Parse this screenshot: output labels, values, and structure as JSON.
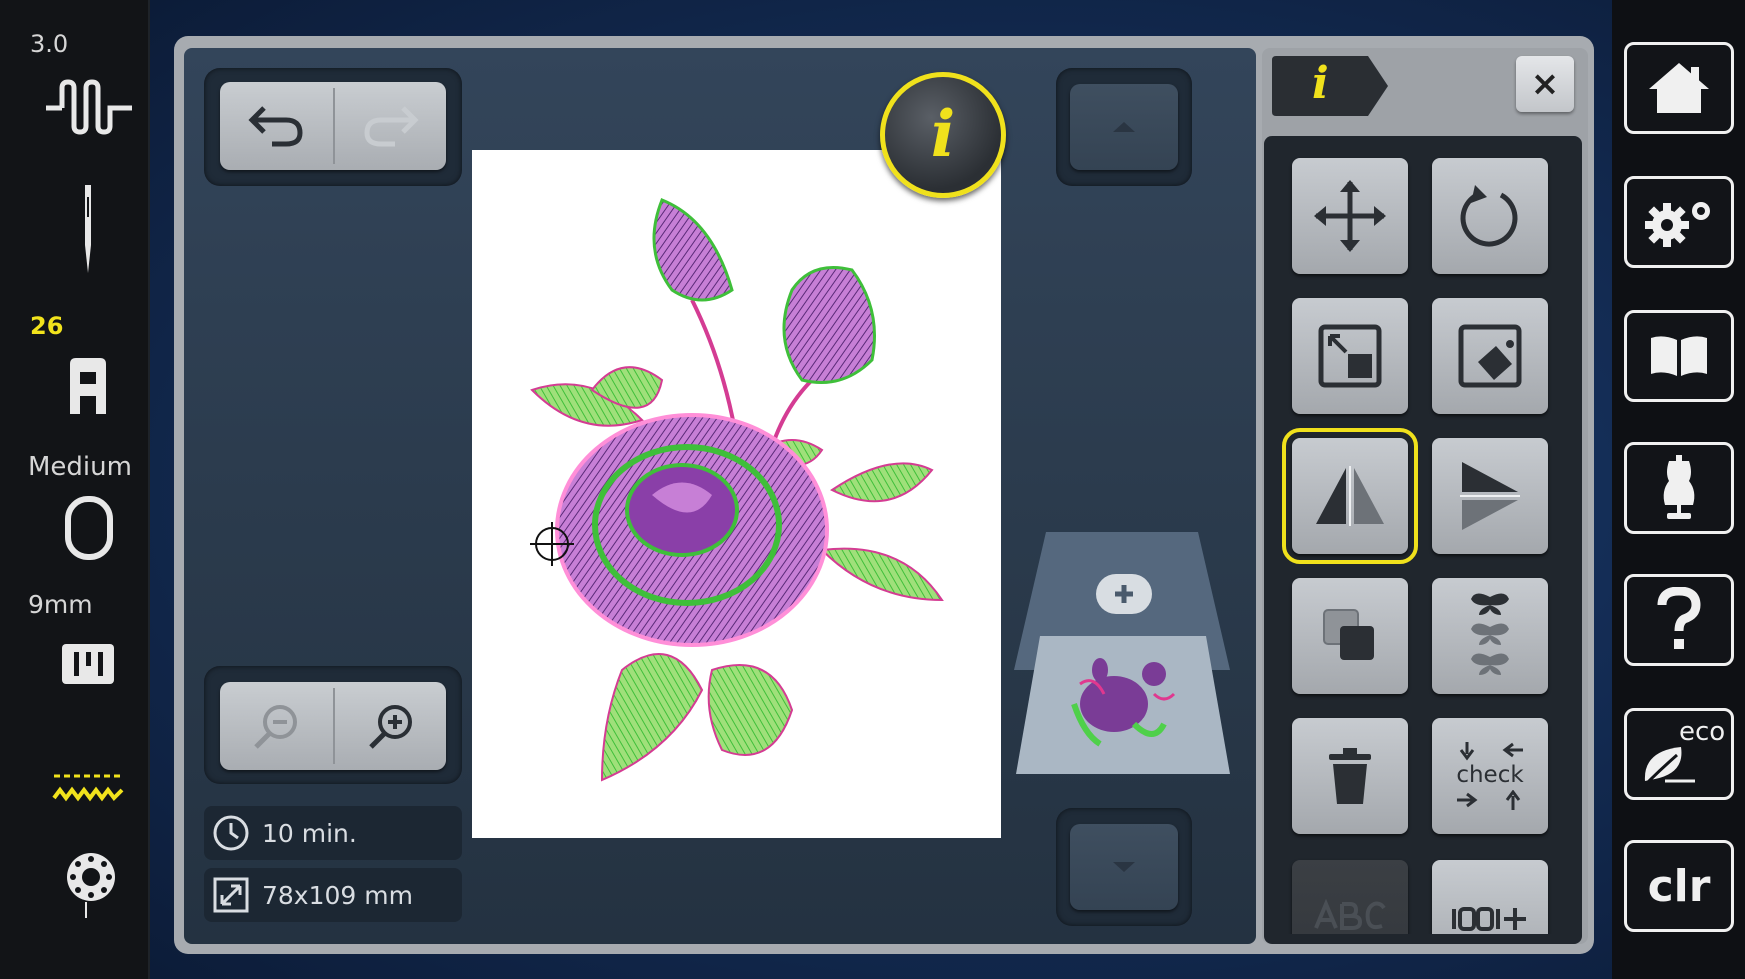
{
  "left_status": {
    "version": "3.0",
    "foot_number": "26",
    "hoop_size": "Medium",
    "stitch_width": "9mm"
  },
  "info_panel": {
    "time_estimate": "10 min.",
    "design_size": "78x109 mm"
  },
  "tool_panel": {
    "info_tab_label": "i",
    "close_label": "×",
    "check_label": "check"
  },
  "floating_info_label": "i",
  "nav": {
    "eco_label": "eco",
    "clr_label": "clr"
  },
  "colors": {
    "accent_yellow": "#f0e11c",
    "panel_bg": "#2b3b4d"
  }
}
